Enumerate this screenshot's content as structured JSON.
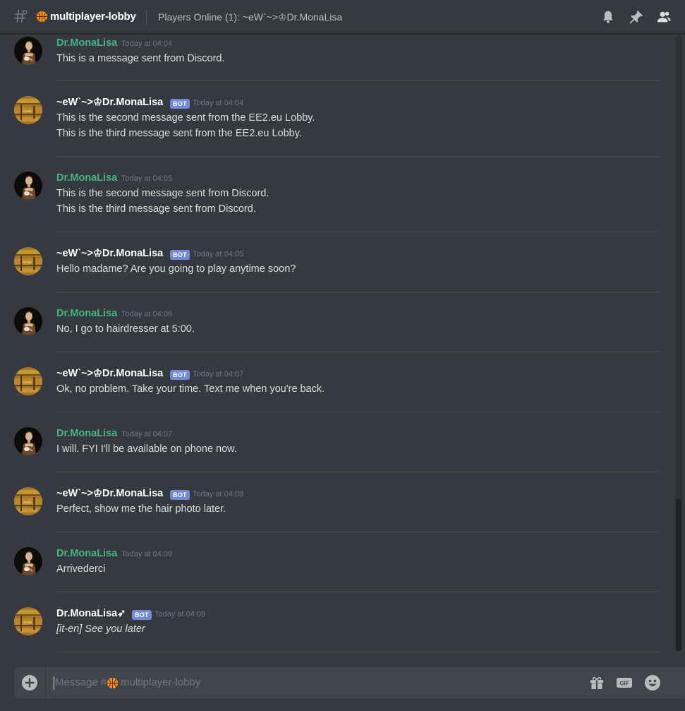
{
  "header": {
    "hash_icon": "channel-hash-icon",
    "channel_emoji": "basketball-emoji",
    "channel_name": "multiplayer-lobby",
    "topic": "Players Online (1): ~eW`~>♔Dr.MonaLisa",
    "icons": [
      "bell-icon",
      "pin-icon",
      "members-icon"
    ]
  },
  "messages": [
    {
      "author": "Dr.MonaLisa",
      "role": "user",
      "bot": false,
      "timestamp": "Today at 04:04",
      "lines": [
        "This is a message sent from Discord."
      ]
    },
    {
      "author": "~eW`~>♔Dr.MonaLisa",
      "role": "bot",
      "bot": true,
      "badge": "BOT",
      "timestamp": "Today at 04:04",
      "lines": [
        "This is the second message sent from the EE2.eu Lobby.",
        "This is the third message sent from the EE2.eu Lobby."
      ]
    },
    {
      "author": "Dr.MonaLisa",
      "role": "user",
      "bot": false,
      "timestamp": "Today at 04:05",
      "lines": [
        "This is the second message sent from Discord.",
        "This is the third message sent from Discord."
      ]
    },
    {
      "author": "~eW`~>♔Dr.MonaLisa",
      "role": "bot",
      "bot": true,
      "badge": "BOT",
      "timestamp": "Today at 04:05",
      "lines": [
        "Hello madame? Are you going to play anytime soon?"
      ]
    },
    {
      "author": "Dr.MonaLisa",
      "role": "user",
      "bot": false,
      "timestamp": "Today at 04:06",
      "lines": [
        "No, I go to hairdresser at 5:00."
      ]
    },
    {
      "author": "~eW`~>♔Dr.MonaLisa",
      "role": "bot",
      "bot": true,
      "badge": "BOT",
      "timestamp": "Today at 04:07",
      "lines": [
        "Ok, no problem. Take your time. Text me when you're back."
      ]
    },
    {
      "author": "Dr.MonaLisa",
      "role": "user",
      "bot": false,
      "timestamp": "Today at 04:07",
      "lines": [
        "I will. FYI I'll be available on phone now."
      ]
    },
    {
      "author": "~eW`~>♔Dr.MonaLisa",
      "role": "bot",
      "bot": true,
      "badge": "BOT",
      "timestamp": "Today at 04:08",
      "lines": [
        "Perfect, show me the hair photo later."
      ]
    },
    {
      "author": "Dr.MonaLisa",
      "role": "user",
      "bot": false,
      "timestamp": "Today at 04:09",
      "lines": [
        "Arrivederci"
      ]
    },
    {
      "author": "Dr.MonaLisa➶",
      "role": "bot",
      "bot": true,
      "badge": "BOT",
      "timestamp": "Today at 04:09",
      "lines": [
        "[it-en] See you later"
      ],
      "italic": true
    }
  ],
  "input": {
    "placeholder_prefix": "Message #",
    "placeholder_emoji": "basketball-emoji",
    "placeholder_channel": "multiplayer-lobby",
    "icons": [
      "add-attachment-icon",
      "gift-icon",
      "gif-icon",
      "emoji-icon"
    ],
    "gif_label": "GIF"
  },
  "colors": {
    "background": "#36393f",
    "username_user": "#43b581",
    "username_bot": "#ffffff",
    "bot_badge": "#7289da",
    "timestamp": "#72767d",
    "input_background": "#40444b"
  }
}
